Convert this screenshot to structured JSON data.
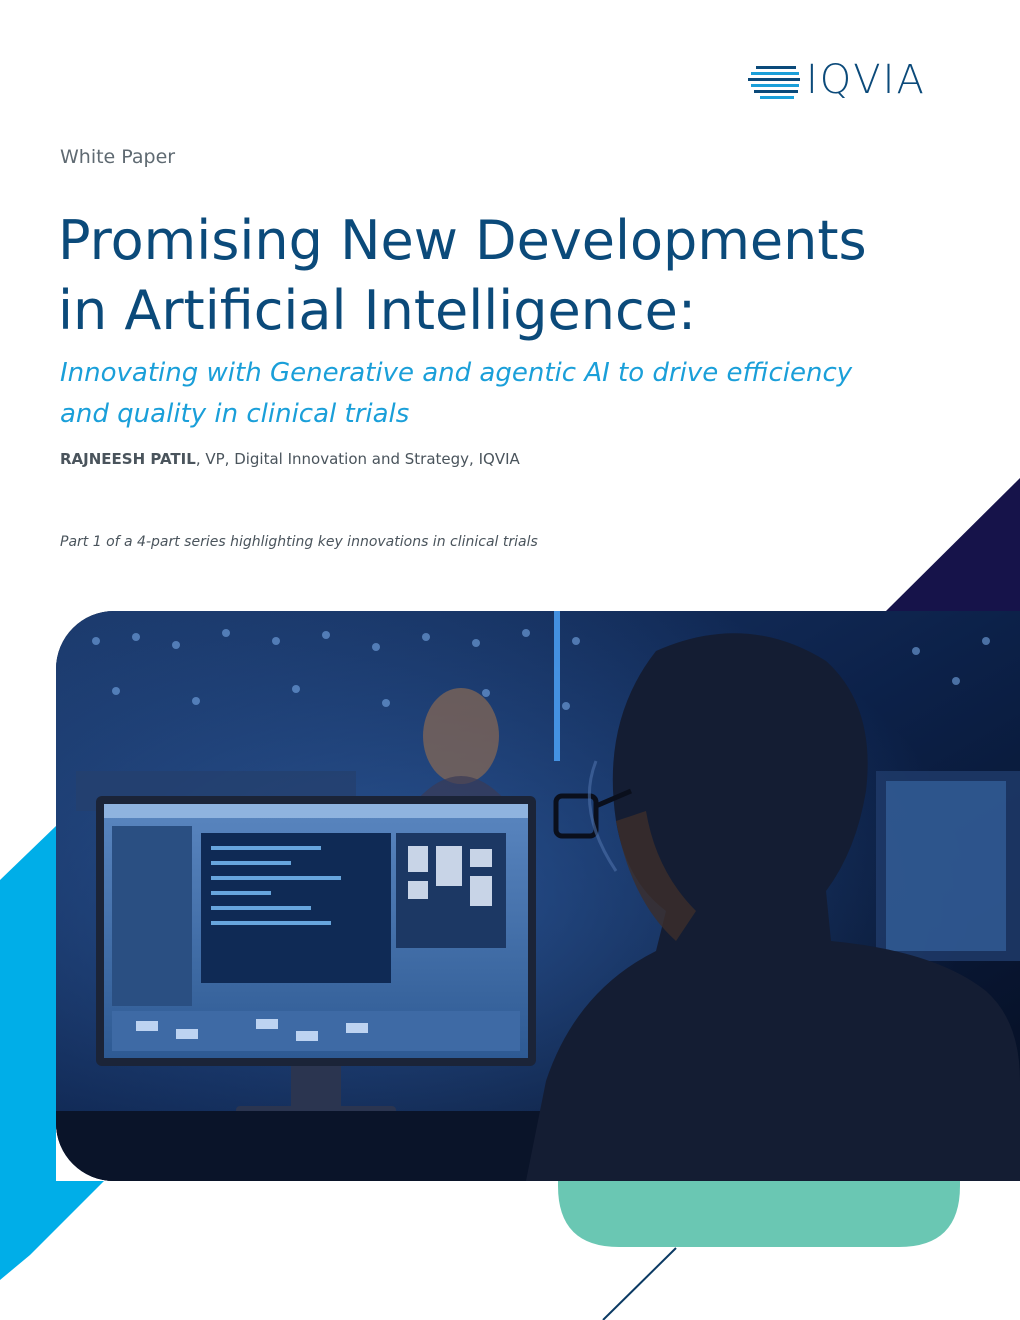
{
  "brand": {
    "logo_text": "IQVIA",
    "colors": {
      "navy": "#0b4a7a",
      "cyan": "#1a9fd9",
      "teal": "#6ac7b3",
      "dark_navy": "#16134a",
      "bright_blue": "#00aee8"
    }
  },
  "document": {
    "type_label": "White Paper",
    "title_line1": "Promising New Developments",
    "title_line2": "in Artificial Intelligence:",
    "subtitle_line1": "Innovating with Generative and agentic AI to drive efficiency",
    "subtitle_line2": "and quality in clinical trials",
    "author_name": "RAJNEESH PATIL",
    "author_role": ", VP, Digital Innovation and Strategy, IQVIA",
    "series_note": "Part 1 of a 4-part series highlighting key innovations in clinical trials"
  },
  "hero_image": {
    "icon": "photo-man-at-computer-icon"
  }
}
